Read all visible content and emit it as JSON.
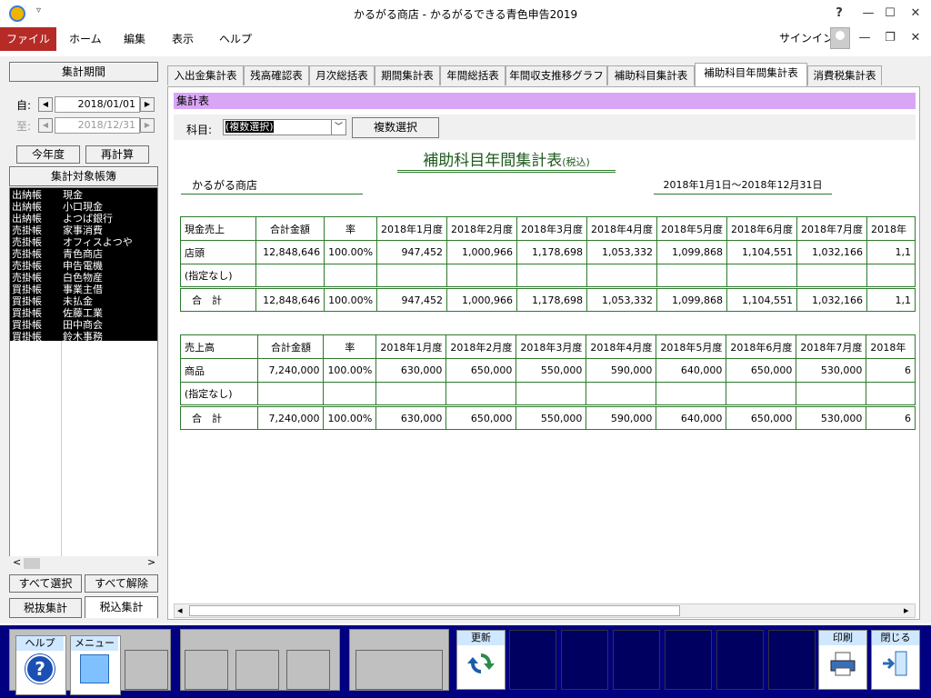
{
  "window": {
    "title": "かるがる商店 - かるがるできる青色申告2019",
    "qat_glyph": "▿",
    "help_glyph": "?",
    "min_glyph": "—",
    "max_glyph": "☐",
    "close_glyph": "✕"
  },
  "menubar": {
    "file": "ファイル",
    "home": "ホーム",
    "edit": "編集",
    "view": "表示",
    "help": "ヘルプ",
    "signin": "サインイン",
    "ribbon_min_glyph": "—",
    "ribbon_restore_glyph": "❐",
    "ribbon_close_glyph": "✕"
  },
  "left_panel": {
    "period_header": "集計期間",
    "from_label": "自:",
    "from_date": "2018/01/01",
    "to_label": "至:",
    "to_date": "2018/12/31",
    "prev_glyph": "◀",
    "next_glyph": "▶",
    "this_year_button": "今年度",
    "recalc_button": "再計算",
    "ledger_header": "集計対象帳簿",
    "ledgers": [
      {
        "book": "出納帳",
        "name": "現金"
      },
      {
        "book": "出納帳",
        "name": "小口現金"
      },
      {
        "book": "出納帳",
        "name": "よつば銀行"
      },
      {
        "book": "売掛帳",
        "name": "家事消費"
      },
      {
        "book": "売掛帳",
        "name": "オフィスよつや"
      },
      {
        "book": "売掛帳",
        "name": "青色商店"
      },
      {
        "book": "売掛帳",
        "name": "申告電機"
      },
      {
        "book": "売掛帳",
        "name": "白色物産"
      },
      {
        "book": "買掛帳",
        "name": "事業主借"
      },
      {
        "book": "買掛帳",
        "name": "未払金"
      },
      {
        "book": "買掛帳",
        "name": "佐藤工業"
      },
      {
        "book": "買掛帳",
        "name": "田中商会"
      },
      {
        "book": "買掛帳",
        "name": "鈴木事務"
      }
    ],
    "scroll_left_glyph": "<",
    "scroll_right_glyph": ">",
    "select_all_button": "すべて選択",
    "deselect_all_button": "すべて解除",
    "tax_excl_tab": "税抜集計",
    "tax_incl_tab": "税込集計"
  },
  "tabs": [
    "入出金集計表",
    "残高確認表",
    "月次総括表",
    "期間集計表",
    "年間総括表",
    "年間収支推移グラフ",
    "補助科目集計表",
    "補助科目年間集計表",
    "消費税集計表"
  ],
  "main": {
    "section_title": "集計表",
    "kamoku_label": "科目:",
    "kamoku_value": "(複数選択)",
    "dropdown_glyph": "﹀",
    "multi_select_button": "複数選択",
    "report_title": "補助科目年間集計表",
    "report_title_suffix": "(税込)",
    "company": "かるがる商店",
    "period": "2018年1月1日～2018年12月31日",
    "hscroll_left_glyph": "◂",
    "hscroll_right_glyph": "▸"
  },
  "table_cash_sales": {
    "headers": [
      "現金売上",
      "合計金額",
      "率",
      "2018年1月度",
      "2018年2月度",
      "2018年3月度",
      "2018年4月度",
      "2018年5月度",
      "2018年6月度",
      "2018年7月度",
      "2018年"
    ],
    "rows": [
      [
        "店頭",
        "12,848,646",
        "100.00%",
        "947,452",
        "1,000,966",
        "1,178,698",
        "1,053,332",
        "1,099,868",
        "1,104,551",
        "1,032,166",
        "1,1"
      ],
      [
        "(指定なし)",
        "",
        "",
        "",
        "",
        "",
        "",
        "",
        "",
        "",
        ""
      ],
      [
        "合　計",
        "12,848,646",
        "100.00%",
        "947,452",
        "1,000,966",
        "1,178,698",
        "1,053,332",
        "1,099,868",
        "1,104,551",
        "1,032,166",
        "1,1"
      ]
    ]
  },
  "table_sales": {
    "headers": [
      "売上高",
      "合計金額",
      "率",
      "2018年1月度",
      "2018年2月度",
      "2018年3月度",
      "2018年4月度",
      "2018年5月度",
      "2018年6月度",
      "2018年7月度",
      "2018年"
    ],
    "rows": [
      [
        "商品",
        "7,240,000",
        "100.00%",
        "630,000",
        "650,000",
        "550,000",
        "590,000",
        "640,000",
        "650,000",
        "530,000",
        "6"
      ],
      [
        "(指定なし)",
        "",
        "",
        "",
        "",
        "",
        "",
        "",
        "",
        "",
        ""
      ],
      [
        "合　計",
        "7,240,000",
        "100.00%",
        "630,000",
        "650,000",
        "550,000",
        "590,000",
        "640,000",
        "650,000",
        "530,000",
        "6"
      ]
    ]
  },
  "bottom_bar": {
    "help_label": "ヘルプ",
    "menu_label": "メニュー",
    "update_label": "更新",
    "print_label": "印刷",
    "close_label": "閉じる",
    "help_glyph": "?"
  }
}
